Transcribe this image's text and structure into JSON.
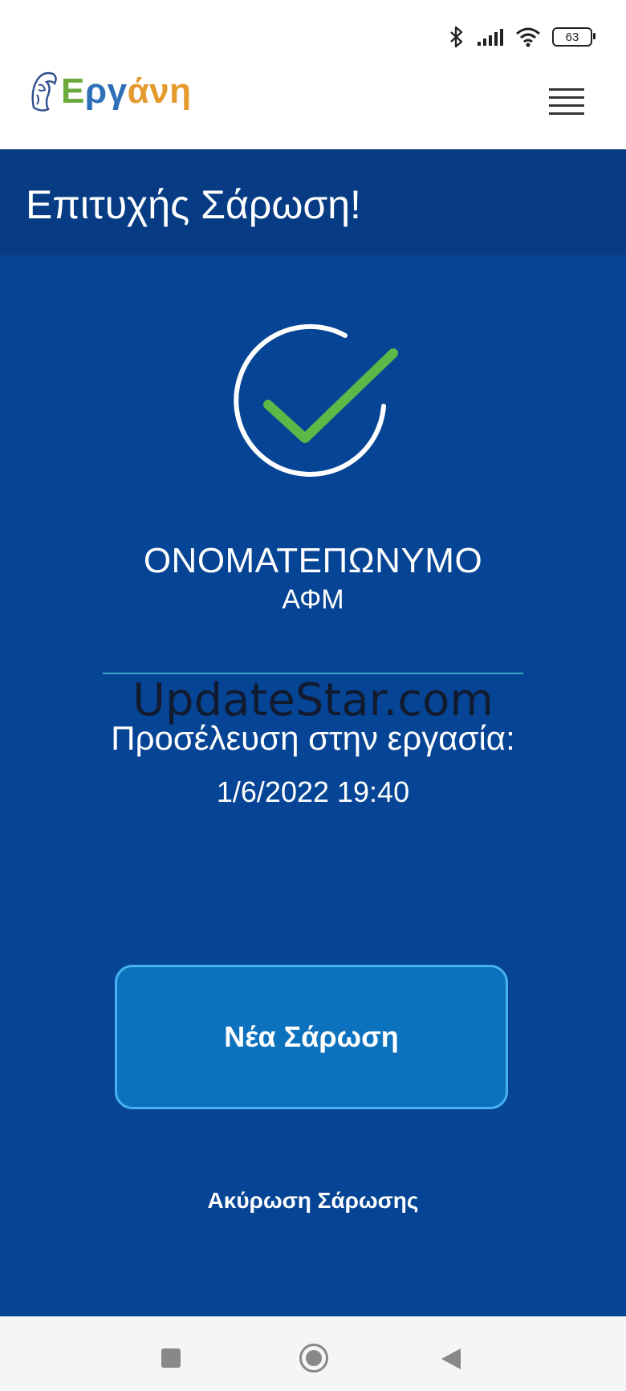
{
  "status_bar": {
    "battery_level": "63"
  },
  "app": {
    "logo_text": [
      "Ε",
      "ργ",
      "άνη"
    ]
  },
  "header": {
    "title": "Επιτυχής Σάρωση!"
  },
  "result": {
    "name": "ΟΝΟΜΑΤΕΠΩΝΥΜΟ",
    "afm": "ΑΦΜ",
    "watermark": "UpdateStar.com",
    "arrival_label": "Προσέλευση στην εργασία:",
    "arrival_time": "1/6/2022 19:40"
  },
  "actions": {
    "new_scan_label": "Νέα Σάρωση",
    "cancel_label": "Ακύρωση Σάρωσης"
  },
  "colors": {
    "header_bg": "#073c85",
    "main_bg": "#064595",
    "button_bg": "#0d72bd",
    "button_border": "#46b3ef",
    "check_green": "#5db848"
  }
}
